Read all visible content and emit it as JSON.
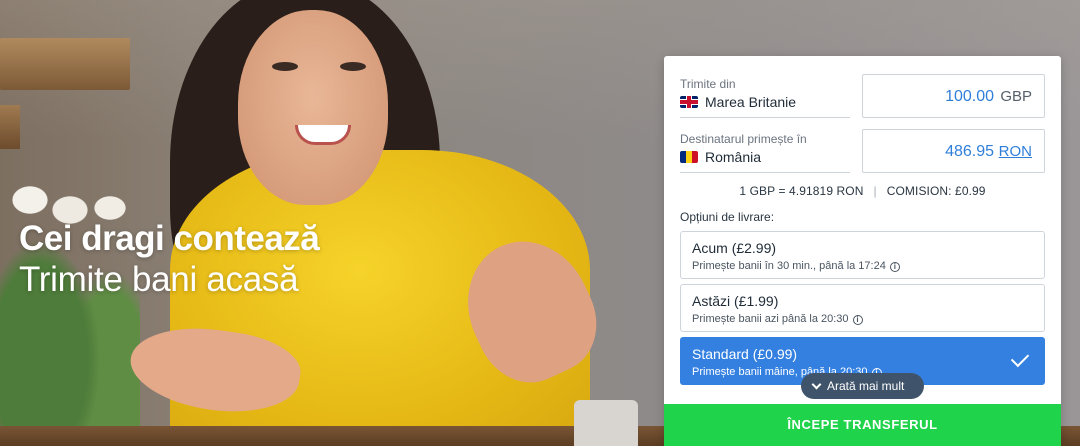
{
  "hero": {
    "headline": "Cei dragi contează",
    "subheadline": "Trimite bani acasă"
  },
  "transfer": {
    "send_from": {
      "label": "Trimite din",
      "country": "Marea Britanie",
      "flag_icon": "uk-flag-icon",
      "amount": "100.00",
      "currency": "GBP"
    },
    "recipient": {
      "label": "Destinatarul primește în",
      "country": "România",
      "flag_icon": "romania-flag-icon",
      "amount": "486.95",
      "currency": "RON"
    },
    "rate_text": "1 GBP = 4.91819 RON",
    "separator": "|",
    "fee_text": "COMISION: £0.99",
    "delivery_title": "Opțiuni de livrare:",
    "delivery_options": [
      {
        "name": "Acum",
        "price": "(£2.99)",
        "detail": "Primește banii în 30 min., până la 17:24",
        "selected": false
      },
      {
        "name": "Astăzi",
        "price": "(£1.99)",
        "detail": "Primește banii azi până la 20:30",
        "selected": false
      },
      {
        "name": "Standard",
        "price": "(£0.99)",
        "detail": "Primește banii mâine, până la 20:30",
        "selected": true
      }
    ],
    "show_more_label": "Arată mai mult",
    "start_button_label": "ÎNCEPE TRANSFERUL"
  },
  "colors": {
    "accent_blue": "#3480e0",
    "cta_green": "#1fd34a",
    "pill_dark": "#3f546a"
  }
}
